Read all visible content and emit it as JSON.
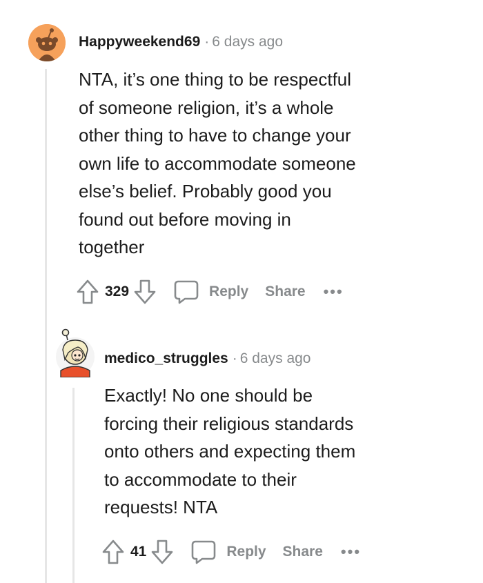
{
  "comments": [
    {
      "author": "Happyweekend69",
      "separator": "·",
      "time": "6 days ago",
      "body_lines": [
        "NTA, it’s one thing to be respectful",
        "of someone religion, it’s a whole",
        "other thing to have to change your",
        "own life to accommodate someone",
        "else’s belief. Probably good you",
        "found out before moving in",
        "together"
      ],
      "score": "329",
      "reply_label": "Reply",
      "share_label": "Share",
      "more_label": "•••"
    },
    {
      "author": "medico_struggles",
      "separator": "·",
      "time": "6 days ago",
      "body_lines": [
        "Exactly! No one should be",
        "forcing their religious standards",
        "onto others and expecting them",
        "to accommodate to their",
        "requests! NTA"
      ],
      "score": "41",
      "reply_label": "Reply",
      "share_label": "Share",
      "more_label": "•••"
    }
  ],
  "icons": {
    "upvote": "upvote-arrow-icon",
    "downvote": "downvote-arrow-icon",
    "reply": "speech-bubble-icon",
    "avatar1": "snoo-avatar-icon",
    "avatar2": "cartoon-avatar-icon"
  },
  "colors": {
    "avatar1_bg": "#f6a15b",
    "muted": "#878a8c",
    "thread_line": "#e6e6e6",
    "avatar2_shirt": "#e8502b"
  }
}
